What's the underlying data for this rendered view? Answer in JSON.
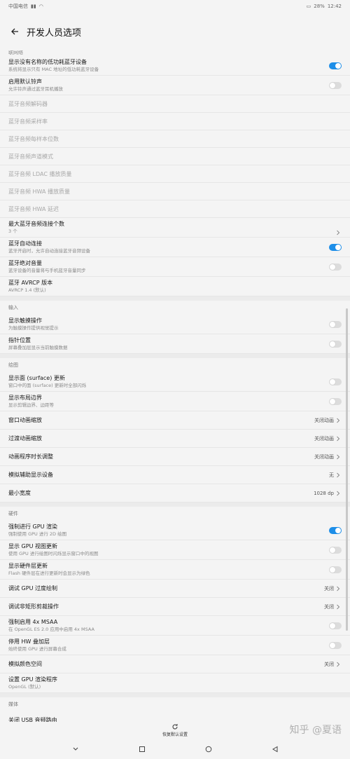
{
  "status": {
    "carrier": "中国电信",
    "battery": "28%",
    "time": "12:42"
  },
  "header": {
    "title": "开发人员选项"
  },
  "cut_label": "联网络",
  "bluetooth": [
    {
      "title": "显示没有名称的低功耗蓝牙设备",
      "subtitle": "系统将显示只有 MAC 地址的低功耗蓝牙设备",
      "toggle": true
    },
    {
      "title": "启用默认铃声",
      "subtitle": "允许铃声通过蓝牙耳机播放",
      "toggle": false
    },
    {
      "title": "蓝牙音频解码器"
    },
    {
      "title": "蓝牙音频采样率"
    },
    {
      "title": "蓝牙音频每样本位数"
    },
    {
      "title": "蓝牙音频声道模式"
    },
    {
      "title": "蓝牙音频 LDAC 播放质量"
    },
    {
      "title": "蓝牙音频 HWA 播放质量"
    },
    {
      "title": "蓝牙音频 HWA 延迟"
    },
    {
      "title": "最大蓝牙音频连接个数",
      "subtitle": "3 个"
    },
    {
      "title": "蓝牙自动连接",
      "subtitle": "蓝牙开启时，允许自动连接蓝牙音频设备",
      "toggle": true
    },
    {
      "title": "蓝牙绝对音量",
      "subtitle": "蓝牙设备的音量将与手机蓝牙音量同步",
      "toggle": false
    },
    {
      "title": "蓝牙 AVRCP 版本",
      "subtitle": "AVRCP 1.4 (默认)"
    }
  ],
  "input_section": "输入",
  "input": [
    {
      "title": "显示触摸操作",
      "subtitle": "为触摸操作提供视觉提示",
      "toggle": false
    },
    {
      "title": "指针位置",
      "subtitle": "屏幕叠加层显示当前触摸数据",
      "toggle": false
    }
  ],
  "drawing_section": "绘图",
  "drawing": [
    {
      "title": "显示面 (surface) 更新",
      "subtitle": "窗口中的面 (surface) 更新时全部闪烁",
      "toggle": false
    },
    {
      "title": "显示布局边界",
      "subtitle": "显示剪辑边界、边距等",
      "toggle": false
    },
    {
      "title": "窗口动画缩放",
      "value": "关闭动画"
    },
    {
      "title": "过渡动画缩放",
      "value": "关闭动画"
    },
    {
      "title": "动画程序时长调整",
      "value": "关闭动画"
    },
    {
      "title": "模拟辅助显示设备",
      "value": "无"
    },
    {
      "title": "最小宽度",
      "value": "1028 dp"
    }
  ],
  "hardware_section": "硬件",
  "hardware": [
    {
      "title": "强制进行 GPU 渲染",
      "subtitle": "强制使用 GPU 进行 2D 绘图",
      "toggle": true
    },
    {
      "title": "显示 GPU 视图更新",
      "subtitle": "使用 GPU 进行绘图时闪烁显示窗口中的视图",
      "toggle": false
    },
    {
      "title": "显示硬件层更新",
      "subtitle": "Flash 硬件层在进行更新时会显示为绿色",
      "toggle": false
    },
    {
      "title": "调试 GPU 过度绘制",
      "value": "关闭"
    },
    {
      "title": "调试非矩形剪裁操作",
      "value": "关闭"
    },
    {
      "title": "强制启用 4x MSAA",
      "subtitle": "在 OpenGL ES 2.0 应用中启用 4x MSAA",
      "toggle": false
    },
    {
      "title": "停用 HW 叠加层",
      "subtitle": "始终使用 GPU 进行屏幕合成",
      "toggle": false
    },
    {
      "title": "模拟颜色空间",
      "value": "关闭"
    },
    {
      "title": "设置 GPU 渲染程序",
      "subtitle": "OpenGL (默认)"
    }
  ],
  "media_section": "媒体",
  "media_cut": "关闭 USB 音频路由",
  "restore_label": "恢复默认设置",
  "watermark": "知乎 @夏语",
  "colors": {
    "accent": "#1d8ee8"
  }
}
